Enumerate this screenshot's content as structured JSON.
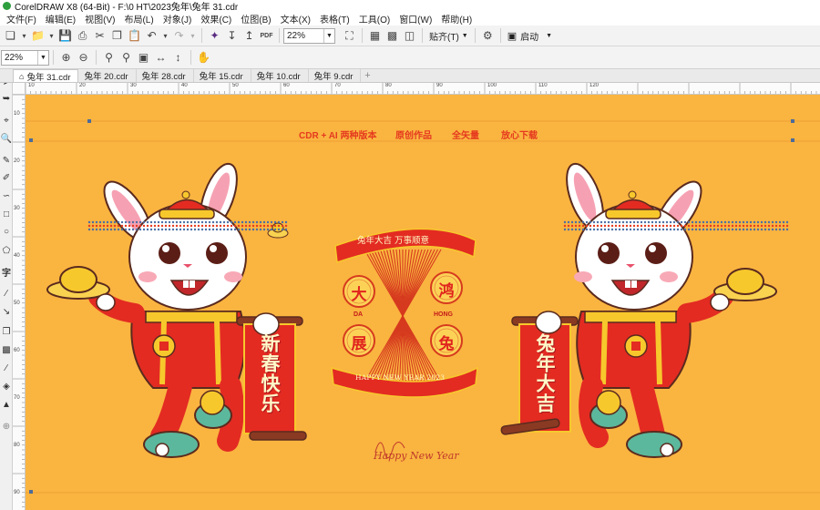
{
  "window": {
    "title": "CorelDRAW X8 (64-Bit) - F:\\0 HT\\2023兔年\\兔年 31.cdr"
  },
  "menu": [
    "文件(F)",
    "编辑(E)",
    "视图(V)",
    "布局(L)",
    "对象(J)",
    "效果(C)",
    "位图(B)",
    "文本(X)",
    "表格(T)",
    "工具(O)",
    "窗口(W)",
    "帮助(H)"
  ],
  "toolbar": {
    "zoom_value": "22%",
    "snap_label": "贴齐(T)",
    "launch_label": "启动",
    "pdf_label": "PDF"
  },
  "propbar": {
    "zoom_value": "22%"
  },
  "tabs": [
    {
      "label": "兔年 31.cdr",
      "active": true
    },
    {
      "label": "兔年 20.cdr",
      "active": false
    },
    {
      "label": "兔年 28.cdr",
      "active": false
    },
    {
      "label": "兔年 15.cdr",
      "active": false
    },
    {
      "label": "兔年 10.cdr",
      "active": false
    },
    {
      "label": "兔年 9.cdr",
      "active": false
    }
  ],
  "ruler": {
    "h_labels": [
      "10",
      "20",
      "30",
      "40",
      "50",
      "60",
      "70",
      "80",
      "90",
      "100",
      "110",
      "120"
    ],
    "v_labels": [
      "10",
      "20",
      "30",
      "40",
      "50",
      "60",
      "70",
      "80",
      "90"
    ]
  },
  "artwork": {
    "banner_segments": [
      "CDR + AI 两种版本",
      "原创作品",
      "全矢量",
      "放心下载"
    ],
    "scroll_left": "新春快乐",
    "scroll_right": "兔年大吉",
    "badge_top": "兔年大吉  万事顺意",
    "badge_bottom": "HAPPY NEW YEAR 2023",
    "medals": [
      "大",
      "鸿",
      "展",
      "兔"
    ],
    "pinyin_left": "DA",
    "pinyin_right": "HONG",
    "signature": "Happy New Year",
    "colors": {
      "background": "#fab440",
      "red": "#e32b22",
      "deep_red": "#b5181e",
      "gold": "#f7c82c",
      "cream": "#fff3c4"
    }
  }
}
